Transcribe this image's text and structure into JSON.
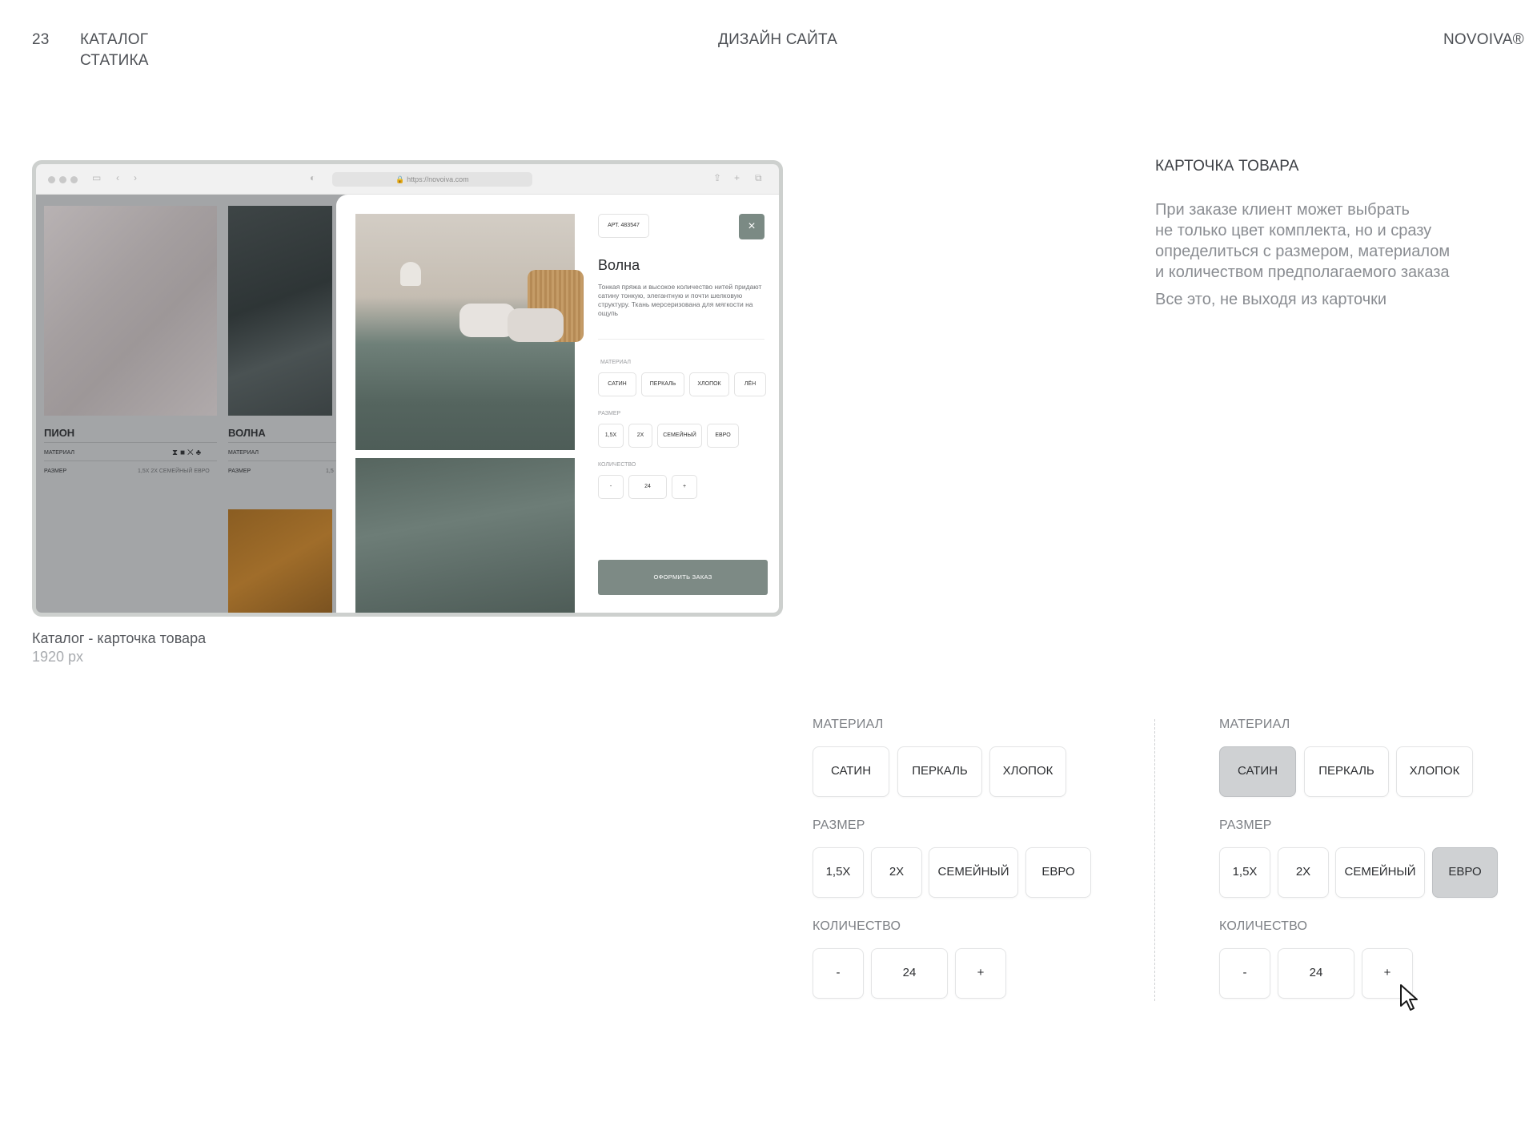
{
  "header": {
    "page_number": "23",
    "section_line1": "КАТАЛОГ",
    "section_line2": "СТАТИКА",
    "center_title": "ДИЗАЙН САЙТА",
    "brand": "NOVOIVA®"
  },
  "info": {
    "title": "КАРТОЧКА ТОВАРА",
    "desc_lines": [
      "При заказе клиент может выбрать",
      "не только цвет комплекта, но и сразу",
      "определиться с размером, материалом",
      "и количеством предполагаемого заказа"
    ],
    "desc2": "Все это, не выходя из карточки"
  },
  "caption": {
    "title": "Каталог - карточка товара",
    "size": "1920 px"
  },
  "browser": {
    "url": "https://novoiva.com",
    "catalog": [
      {
        "name": "ПИОН",
        "material_label": "МАТЕРИАЛ",
        "size_label": "РАЗМЕР",
        "sizes": "1,5Х   2Х   СЕМЕЙНЫЙ   ЕВРО"
      },
      {
        "name": "ВОЛНА",
        "material_label": "МАТЕРИАЛ",
        "size_label": "РАЗМЕР",
        "sizes": "1,5"
      }
    ],
    "modal": {
      "article": "АРТ. 483547",
      "close_icon": "×",
      "title": "Волна",
      "description": "Тонкая пряжа и высокое количество нитей придают сатину тонкую, элегантную и почти шелковую структуру. Ткань мерсеризована для мягкости на ощупь",
      "material_label": "МАТЕРИАЛ",
      "materials": [
        "САТИН",
        "ПЕРКАЛЬ",
        "ХЛОПОК",
        "ЛЁН"
      ],
      "size_label": "РАЗМЕР",
      "sizes": [
        "1,5Х",
        "2Х",
        "СЕМЕЙНЫЙ",
        "ЕВРО"
      ],
      "quantity_label": "КОЛИЧЕСТВО",
      "minus": "-",
      "quantity": "24",
      "plus": "+",
      "order_button": "ОФОРМИТЬ ЗАКАЗ"
    }
  },
  "panels": [
    {
      "state": "default",
      "material_label": "МАТЕРИАЛ",
      "materials": [
        "САТИН",
        "ПЕРКАЛЬ",
        "ХЛОПОК"
      ],
      "size_label": "РАЗМЕР",
      "sizes": [
        "1,5Х",
        "2Х",
        "СЕМЕЙНЫЙ",
        "ЕВРО"
      ],
      "quantity_label": "КОЛИЧЕСТВО",
      "minus": "-",
      "quantity": "24",
      "plus": "+"
    },
    {
      "state": "selected",
      "material_label": "МАТЕРИАЛ",
      "materials": [
        "САТИН",
        "ПЕРКАЛЬ",
        "ХЛОПОК"
      ],
      "selected_material": "САТИН",
      "size_label": "РАЗМЕР",
      "sizes": [
        "1,5Х",
        "2Х",
        "СЕМЕЙНЫЙ",
        "ЕВРО"
      ],
      "selected_size": "ЕВРО",
      "quantity_label": "КОЛИЧЕСТВО",
      "minus": "-",
      "quantity": "24",
      "plus": "+"
    }
  ],
  "colors": {
    "selected_chip": "#cfd1d3",
    "order_button": "#7d8a85",
    "close_button": "#7b8a84"
  }
}
